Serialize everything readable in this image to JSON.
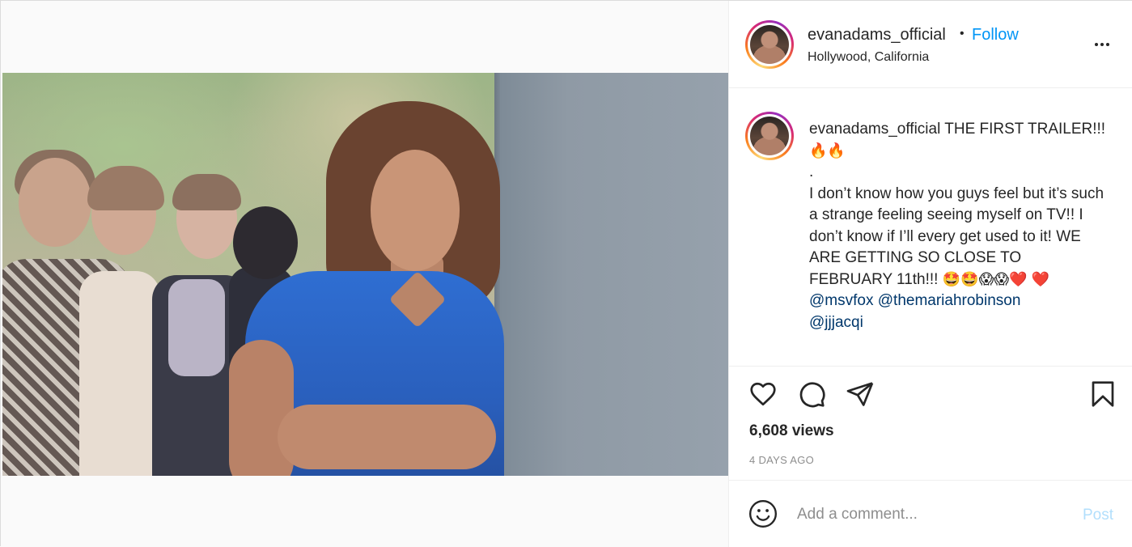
{
  "post": {
    "username": "evanadams_official",
    "dot": "•",
    "follow_label": "Follow",
    "location": "Hollywood, California",
    "more_icon": "more-horizontal-icon"
  },
  "caption": {
    "username": "evanadams_official",
    "line1": "THE FIRST TRAILER!!!",
    "fire_emojis": "🔥🔥",
    "dot_line": ".",
    "body": "I don’t know how you guys feel but it’s such a strange feeling seeing myself on TV!! I don’t know if I’ll every get used to it! WE ARE GETTING SO CLOSE TO FEBRUARY 11th!!!",
    "end_emojis": "🤩🤩😱😱❤️",
    "heart_emoji": "❤️",
    "mentions": [
      "@msvfox",
      "@themariahrobinson",
      "@jjjacqi"
    ]
  },
  "actions": {
    "like_icon": "heart-icon",
    "comment_icon": "comment-icon",
    "share_icon": "paper-plane-icon",
    "save_icon": "bookmark-icon",
    "views": "6,608 views",
    "age": "4 DAYS AGO"
  },
  "comment_box": {
    "emoji_icon": "smiley-icon",
    "placeholder": "Add a comment...",
    "post_label": "Post"
  },
  "video": {
    "mute_icon": "muted-speaker-icon"
  },
  "colors": {
    "accent": "#0095f6",
    "mention": "#00376b",
    "post_disabled": "#b2dffc",
    "muted_text": "#8e8e8e"
  }
}
